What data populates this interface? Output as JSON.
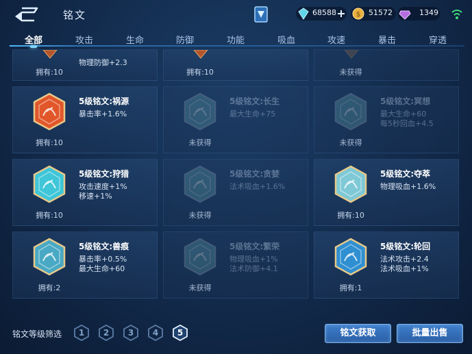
{
  "header": {
    "title": "铭文",
    "resources": [
      {
        "name": "diamond",
        "value": "68588",
        "icon": "diamond-icon",
        "has_add": true
      },
      {
        "name": "gold",
        "value": "51572",
        "icon": "gold-coin-icon"
      },
      {
        "name": "gem",
        "value": "1349",
        "icon": "purple-gem-icon"
      }
    ]
  },
  "tabs": [
    "全部",
    "攻击",
    "生命",
    "防御",
    "功能",
    "吸血",
    "攻速",
    "暴击",
    "穿透"
  ],
  "active_tab": "全部",
  "top_row": [
    {
      "stat": "物理防御+2.3",
      "own": "拥有:10"
    },
    {
      "own": "拥有:10"
    },
    {
      "own": "未获得"
    }
  ],
  "cards": [
    {
      "name": "5级铭文:祸源",
      "stats": [
        "暴击率+1.6%"
      ],
      "own": "拥有:10",
      "locked": false,
      "color": "#e2572a"
    },
    {
      "name": "5级铭文:长生",
      "stats": [
        "最大生命+75"
      ],
      "own": "未获得",
      "locked": true,
      "color": "#5a9aa6"
    },
    {
      "name": "5级铭文:冥想",
      "stats": [
        "最大生命+60",
        "每5秒回血+4.5"
      ],
      "own": "未获得",
      "locked": true,
      "color": "#5a9aa6"
    },
    {
      "name": "5级铭文:狩猎",
      "stats": [
        "攻击速度+1%",
        "移速+1%"
      ],
      "own": "拥有:10",
      "locked": false,
      "color": "#3fc6d8"
    },
    {
      "name": "5级铭文:贪婪",
      "stats": [
        "法术吸血+1.6%"
      ],
      "own": "未获得",
      "locked": true,
      "color": "#5a9aa6"
    },
    {
      "name": "5级铭文:夺萃",
      "stats": [
        "物理吸血+1.6%"
      ],
      "own": "拥有:10",
      "locked": false,
      "color": "#7fc9d6"
    },
    {
      "name": "5级铭文:兽痕",
      "stats": [
        "暴击率+0.5%",
        "最大生命+60"
      ],
      "own": "拥有:2",
      "locked": false,
      "color": "#49a9c4"
    },
    {
      "name": "5级铭文:繁荣",
      "stats": [
        "物理吸血+1%",
        "法术防御+4.1"
      ],
      "own": "未获得",
      "locked": true,
      "color": "#5a9aa6"
    },
    {
      "name": "5级铭文:轮回",
      "stats": [
        "法术攻击+2.4",
        "法术吸血+1%"
      ],
      "own": "拥有:1",
      "locked": false,
      "color": "#2f8fd1"
    }
  ],
  "footer": {
    "filter_label": "铭文等级筛选",
    "levels": [
      "1",
      "2",
      "3",
      "4",
      "5"
    ],
    "active_level": "5",
    "obtain_button": "铭文获取",
    "sell_button": "批量出售"
  }
}
